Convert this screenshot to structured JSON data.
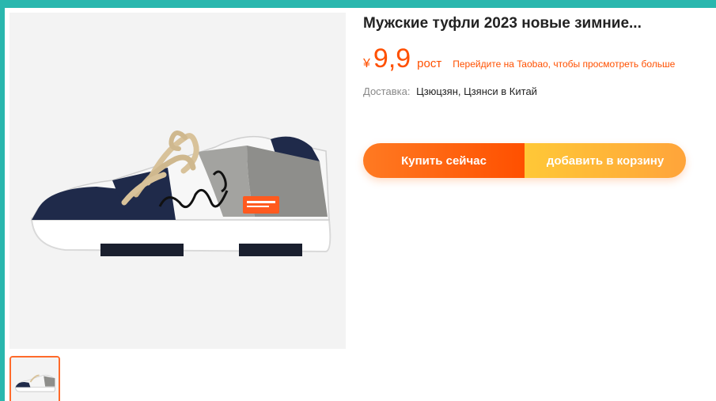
{
  "product": {
    "title": "Мужские туфли 2023 новые зимние...",
    "currency": "¥",
    "price": "9,9",
    "price_suffix": "рост",
    "taobao_link": "Перейдите на Taobao, чтобы просмотреть больше",
    "delivery_label": "Доставка:",
    "delivery_value": "Цзюцзян, Цзянси в Китай"
  },
  "actions": {
    "buy_label": "Купить сейчас",
    "cart_label": "добавить в корзину"
  },
  "colors": {
    "accent": "#ff5000",
    "cart": "#ffb23a",
    "frame": "#2ab7ae"
  },
  "images": {
    "main": "sneaker-image",
    "thumbnail": "sneaker-thumbnail"
  }
}
